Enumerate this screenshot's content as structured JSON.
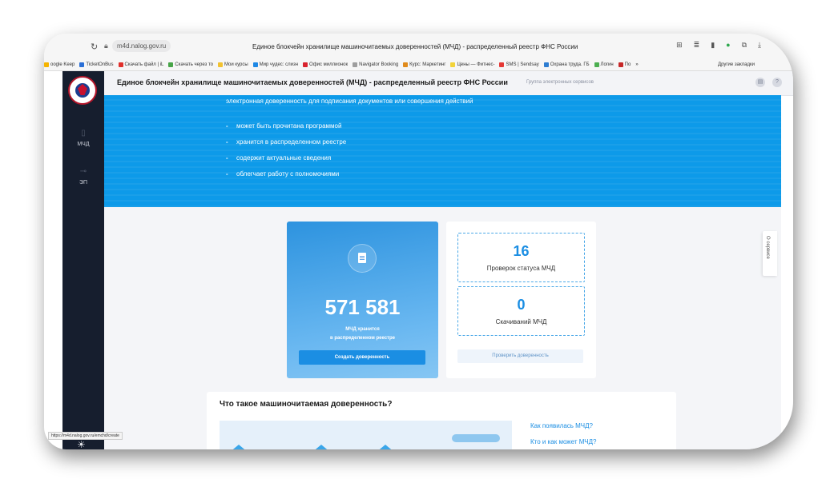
{
  "browser": {
    "url": "m4d.nalog.gov.ru",
    "tab_title": "Единое блокчейн хранилище машиночитаемых доверенностей (МЧД) - распределенный реестр ФНС России",
    "status_url": "https://m4d.nalog.gov.ru/emchd/create",
    "bookmarks": [
      {
        "label": "oogle Keep",
        "color": "#f5b400"
      },
      {
        "label": "TicketOnBus",
        "color": "#2a6fd6"
      },
      {
        "label": "Скачать файл | iL",
        "color": "#e0302b"
      },
      {
        "label": "Скачать через то",
        "color": "#47a447"
      },
      {
        "label": "Мои курсы",
        "color": "#f2c230"
      },
      {
        "label": "Мир чудес: слизн",
        "color": "#1e88e5"
      },
      {
        "label": "Офис миллионок",
        "color": "#d9232e"
      },
      {
        "label": "Navigator Booking",
        "color": "#9e9e9e"
      },
      {
        "label": "Курс: Маркетинг",
        "color": "#e08b1c"
      },
      {
        "label": "Цены — Фитнес-",
        "color": "#f2d33a"
      },
      {
        "label": "SMS | Sendsay",
        "color": "#e53935"
      },
      {
        "label": "Охрана труда. ГБ",
        "color": "#2e7dd1"
      },
      {
        "label": "Логин",
        "color": "#4caf50"
      },
      {
        "label": "По",
        "color": "#c62828"
      }
    ],
    "more_bookmarks": "»",
    "other_bookmarks": "Другие закладки"
  },
  "header": {
    "title": "Единое блокчейн хранилище машиночитаемых доверенностей (МЧД) - распределенный реестр ФНС России",
    "subtitle": "Группа электронных сервисов"
  },
  "sidebar": {
    "items": [
      {
        "label": "МЧД",
        "icon": "document-icon"
      },
      {
        "label": "ЭП",
        "icon": "key-icon"
      }
    ]
  },
  "banner": {
    "top_text": "электронная доверенность для подписания документов или совершения действий",
    "bullets": [
      "может быть прочитана программой",
      "хранится в распределенном реестре",
      "содержит актуальные сведения",
      "облегчает работу с полномочиями"
    ]
  },
  "stats": {
    "total": "571 581",
    "caption_line1": "МЧД хранится",
    "caption_line2": "в распределенном реестре",
    "create_button": "Создать доверенность",
    "checks_count": "16",
    "checks_label": "Проверок статуса МЧД",
    "downloads_count": "0",
    "downloads_label": "Скачиваний МЧД",
    "check_button": "Проверить доверенность"
  },
  "about_tab": "О сервисе",
  "whatis": {
    "title": "Что такое машиночитаемая доверенность?",
    "link1": "Как появилась МЧД?",
    "link2": "Кто и как может МЧД?"
  }
}
